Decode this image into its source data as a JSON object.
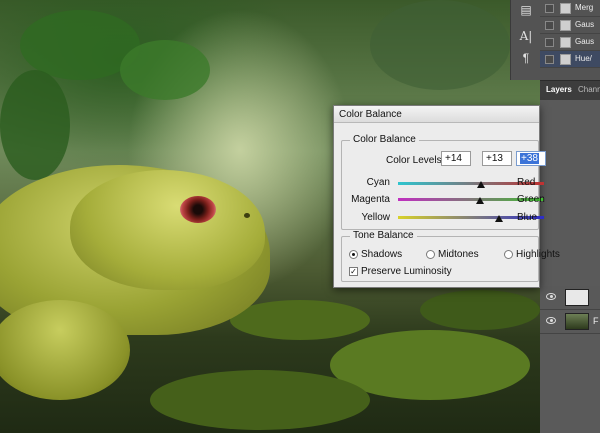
{
  "dialog": {
    "title": "Color Balance",
    "color_balance_group": "Color Balance",
    "color_levels_label": "Color Levels:",
    "levels": [
      "+14",
      "+13",
      "+38"
    ],
    "sliders": [
      {
        "left": "Cyan",
        "right": "Red",
        "value": 14
      },
      {
        "left": "Magenta",
        "right": "Green",
        "value": 13
      },
      {
        "left": "Yellow",
        "right": "Blue",
        "value": 38
      }
    ],
    "slider_range": [
      -100,
      100
    ],
    "tone_balance_group": "Tone Balance",
    "tones": [
      {
        "label": "Shadows",
        "selected": true
      },
      {
        "label": "Midtones",
        "selected": false
      },
      {
        "label": "Highlights",
        "selected": false
      }
    ],
    "preserve_luminosity_label": "Preserve Luminosity",
    "preserve_luminosity": true
  },
  "history": {
    "items": [
      {
        "label": "Merg",
        "selected": false
      },
      {
        "label": "Gaus",
        "selected": false
      },
      {
        "label": "Gaus",
        "selected": false
      },
      {
        "label": "Hue/",
        "selected": true
      }
    ]
  },
  "layers": {
    "tabs": [
      "Layers",
      "Channe"
    ],
    "visible_label": "F"
  },
  "colors": {
    "track_cyan": "#2ec5cf",
    "track_red": "#c03030",
    "track_magenta": "#c02fc0",
    "track_green": "#3fc030",
    "track_yellow": "#d8d22a",
    "track_blue": "#2b2bc8",
    "selection": "#3b73d8"
  }
}
